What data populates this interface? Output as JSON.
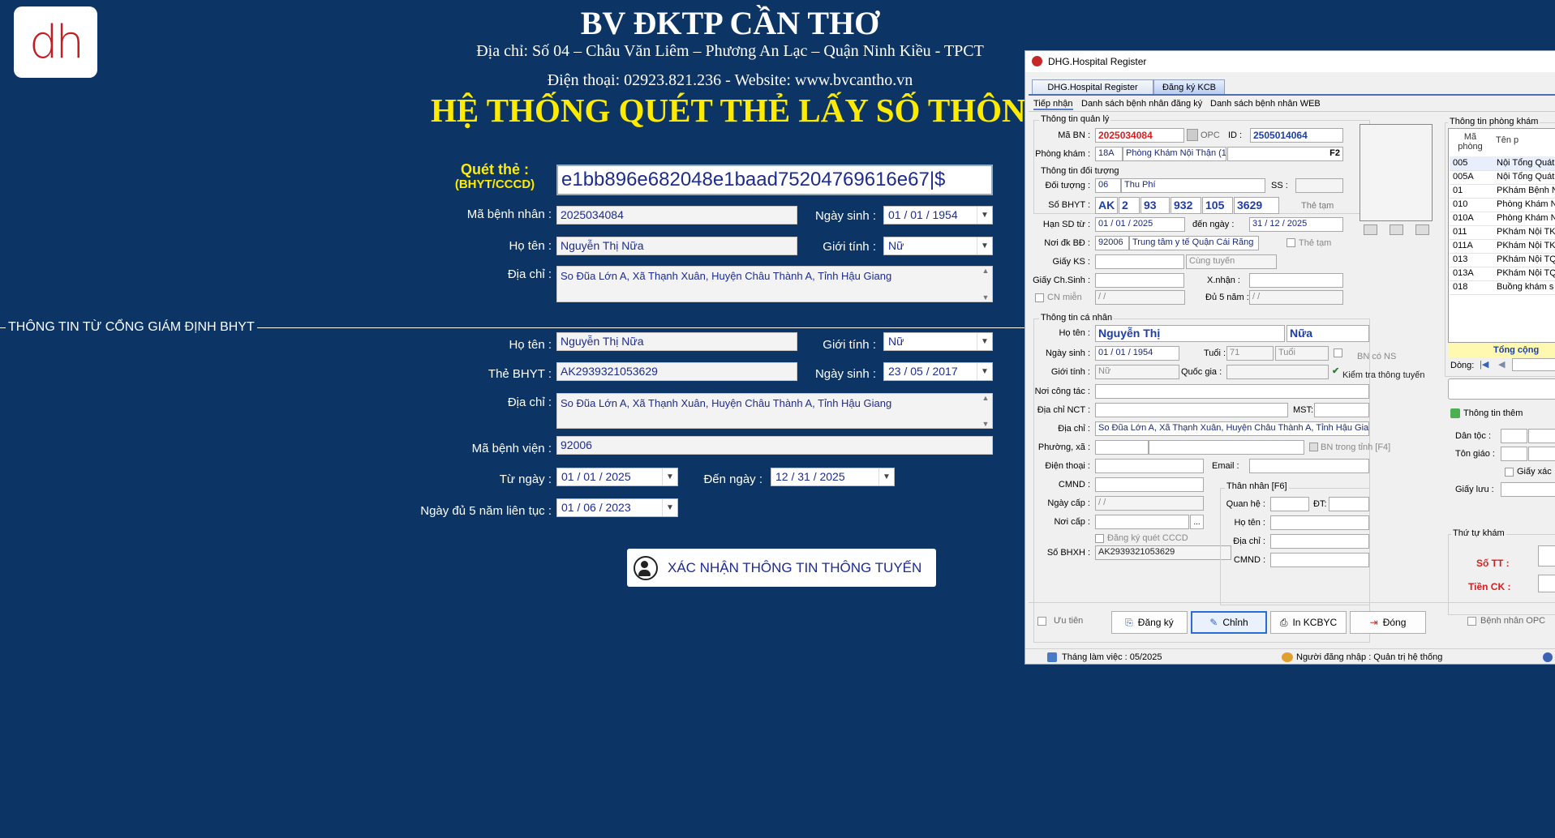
{
  "kiosk": {
    "logo_text": "dh",
    "hospital_name": "BV ĐKTP CẦN THƠ",
    "address": "Địa chỉ: Số 04 – Châu Văn Liêm – Phương An Lạc – Quận Ninh Kiều - TPCT",
    "contact": "Điện thoại: 02923.821.236 - Website: www.bvcantho.vn",
    "system_title": "HỆ THỐNG QUÉT THẺ LẤY SỐ THÔNG",
    "scan_label_1": "Quét thẻ :",
    "scan_label_2": "(BHYT/CCCD)",
    "scan_value": "e1bb896e682048e1baad75204769616e67|$",
    "patient": {
      "ma_bn_label": "Mã bệnh nhân :",
      "ma_bn": "2025034084",
      "ngay_sinh_label": "Ngày sinh :",
      "ngay_sinh": "01 / 01 / 1954",
      "ho_ten_label": "Họ tên :",
      "ho_ten": "Nguyễn Thị Nữa",
      "gioi_tinh_label": "Giới tính :",
      "gioi_tinh": "Nữ",
      "dia_chi_label": "Địa chỉ :",
      "dia_chi": "So Đũa Lớn A, Xã Thạnh Xuân, Huyện Châu Thành A, Tỉnh Hậu Giang"
    },
    "section_title": "THÔNG TIN TỪ CỔNG GIÁM ĐỊNH BHYT",
    "gateway": {
      "ho_ten_label": "Họ tên :",
      "ho_ten": "Nguyễn Thị Nữa",
      "gioi_tinh_label": "Giới tính :",
      "gioi_tinh": "Nữ",
      "the_bhyt_label": "Thẻ BHYT :",
      "the_bhyt": "AK2939321053629",
      "ngay_sinh_label": "Ngày sinh :",
      "ngay_sinh": "23 / 05 / 2017",
      "dia_chi_label": "Địa chỉ :",
      "dia_chi": "So Đũa Lớn A, Xã Thạnh Xuân, Huyện Châu Thành A, Tỉnh Hậu Giang",
      "ma_bv_label": "Mã bệnh viện :",
      "ma_bv": "92006",
      "tu_ngay_label": "Từ ngày :",
      "tu_ngay": "01 / 01 / 2025",
      "den_ngay_label": "Đến ngày :",
      "den_ngay": "12 / 31 / 2025",
      "du5_label": "Ngày đủ 5 năm liên tục :",
      "du5": "01 / 06 / 2023"
    },
    "confirm_button": "XÁC NHẬN THÔNG TIN THÔNG TUYẾN"
  },
  "window": {
    "title": "DHG.Hospital Register",
    "tabs": [
      "DHG.Hospital Register",
      "Đăng ký KCB"
    ],
    "subtabs": [
      "Tiếp nhận",
      "Danh sách bệnh nhân đăng ký",
      "Danh sách bệnh nhân WEB"
    ],
    "quan_ly": {
      "group": "Thông tin quản lý",
      "ma_bn_label": "Mã BN :",
      "ma_bn": "2025034084",
      "opc_label": "OPC",
      "id_label": "ID :",
      "id": "2505014064",
      "phong_kham_label": "Phòng khám :",
      "phong_code": "18A",
      "phong_name": "Phòng Khám Nội Thận (1",
      "f2": "F2"
    },
    "doi_tuong": {
      "group": "Thông tin đối tượng",
      "doi_tuong_label": "Đối tượng :",
      "doi_tuong_code": "06",
      "doi_tuong_name": "Thu Phí",
      "ss_label": "SS :",
      "so_bhyt_label": "Số BHYT :",
      "bhyt_parts": [
        "AK",
        "2",
        "93",
        "932",
        "105",
        "3629"
      ],
      "the_tam": "Thẻ tạm",
      "han_sd_label": "Hạn SD từ :",
      "han_tu": "01 / 01 / 2025",
      "den_ngay_label": "đến ngày :",
      "han_den": "31 / 12 / 2025",
      "noi_dk_label": "Nơi đk BĐ :",
      "noi_dk_code": "92006",
      "noi_dk_name": "Trung tâm y tế Quận Cái Răng",
      "the_tam2": "Thẻ tạm",
      "giay_ks_label": "Giấy KS :",
      "cung_tuyen": "Cùng tuyến",
      "giay_chsinh_label": "Giấy Ch.Sinh :",
      "xnhan_label": "X.nhận :",
      "cn_mien_label": "CN miễn",
      "cn_mien_date": "/    /",
      "du5_label": "Đủ 5 năm :",
      "du5_date": "/    /"
    },
    "ca_nhan": {
      "group": "Thông tin cá nhân",
      "ho_ten_label": "Họ tên :",
      "ho": "Nguyễn Thị",
      "ten": "Nữa",
      "ngay_sinh_label": "Ngày sinh :",
      "ngay_sinh": "01 / 01 / 1954",
      "tuoi_label": "Tuổi :",
      "tuoi": "71",
      "tuoi_unit": "Tuổi",
      "bn_co_ns": "BN có NS",
      "gioi_tinh_label": "Giới tính :",
      "gioi_tinh": "Nữ",
      "quoc_gia_label": "Quốc gia :",
      "kiem_tra": "Kiểm tra thông tuyến",
      "noi_cong_tac_label": "Nơi công tác :",
      "dia_chi_nct_label": "Địa chỉ NCT :",
      "mst_label": "MST:",
      "dia_chi_label": "Địa chỉ :",
      "dia_chi": "So Đũa Lớn A, Xã Thạnh Xuân, Huyện Châu Thành A, Tỉnh Hậu Giang",
      "phuong_xa_label": "Phường, xã :",
      "bn_trong_tinh": "BN trong tỉnh [F4]",
      "dien_thoai_label": "Điện thoại :",
      "email_label": "Email :",
      "cmnd_label": "CMND :",
      "ngay_cap_label": "Ngày cấp :",
      "ngay_cap": "/    /",
      "noi_cap_label": "Nơi cấp :",
      "dk_cccd": "Đăng ký quét CCCD",
      "so_bhxh_label": "Số BHXH :",
      "so_bhxh": "AK2939321053629"
    },
    "than_nhan": {
      "group": "Thân nhân [F6]",
      "quan_he_label": "Quan hệ :",
      "dt_label": "ĐT:",
      "ho_ten_label": "Họ tên :",
      "dia_chi_label": "Địa chỉ :",
      "cmnd_label": "CMND :"
    },
    "phong_kham_panel": {
      "group": "Thông tin phòng khám",
      "col_ma": "Mã phòng",
      "col_ten": "Tên p",
      "rows": [
        [
          "005",
          "Nội Tổng Quát"
        ],
        [
          "005A",
          "Nội Tổng Quát"
        ],
        [
          "01",
          "PKhám Bệnh N"
        ],
        [
          "010",
          "Phòng Khám N"
        ],
        [
          "010A",
          "Phòng Khám N"
        ],
        [
          "011",
          "PKhám Nội TK"
        ],
        [
          "011A",
          "PKhám Nội TK"
        ],
        [
          "013",
          "PKhám Nội TQ"
        ],
        [
          "013A",
          "PKhám Nội TQ"
        ],
        [
          "018",
          "Buồng khám s"
        ]
      ],
      "tong_cong": "Tổng cộng",
      "dong_label": "Dòng:"
    },
    "them": {
      "tab": "Thông tin thêm",
      "dan_toc_label": "Dân tộc :",
      "ton_giao_label": "Tôn giáo :",
      "giay_xac": "Giấy xác",
      "giay_luu_label": "Giấy lưu :"
    },
    "thu_tu": {
      "group": "Thứ tự khám",
      "so_tt_label": "Số TT :",
      "tien_ck_label": "Tiền CK :"
    },
    "bottom": {
      "uu_tien": "Ưu tiên",
      "dang_ky": "Đăng ký",
      "chinh": "Chỉnh",
      "in_kcbyc": "In KCBYC",
      "dong": "Đóng",
      "benh_nhan_opc": "Bệnh nhân OPC"
    },
    "status": {
      "thang": "Tháng làm việc : 05/2025",
      "nguoi_dn": "Người đăng nhập : Quản trị hệ thống"
    }
  },
  "colors": {
    "kiosk_bg": "#0c3565",
    "yellow": "#ffeb00",
    "field_text": "#1d2c8f",
    "red": "#d71f1f"
  }
}
